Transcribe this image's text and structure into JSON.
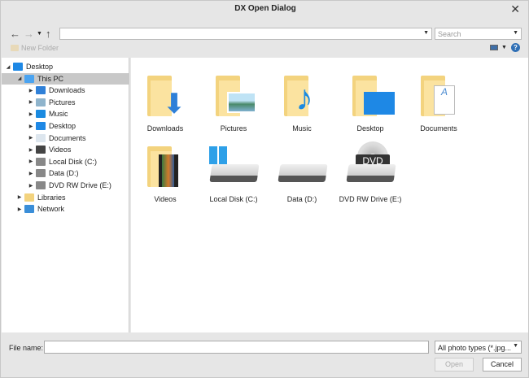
{
  "window": {
    "title": "DX Open Dialog"
  },
  "toolbar": {
    "back": "←",
    "forward": "→",
    "up": "↑",
    "address": "",
    "search_placeholder": "Search",
    "new_folder": "New Folder"
  },
  "tree": [
    {
      "label": "Desktop",
      "level": 0,
      "expanded": true,
      "icon": "desktop-icon",
      "color": "#1e88e5"
    },
    {
      "label": "This PC",
      "level": 1,
      "expanded": true,
      "selected": true,
      "icon": "pc-icon",
      "color": "#4aa3f0"
    },
    {
      "label": "Downloads",
      "level": 2,
      "icon": "downloads-icon",
      "color": "#2f80d8"
    },
    {
      "label": "Pictures",
      "level": 2,
      "icon": "pictures-icon",
      "color": "#8fb4cc"
    },
    {
      "label": "Music",
      "level": 2,
      "icon": "music-icon",
      "color": "#1a8ae0"
    },
    {
      "label": "Desktop",
      "level": 2,
      "icon": "desktop-icon",
      "color": "#1e88e5"
    },
    {
      "label": "Documents",
      "level": 2,
      "icon": "documents-icon",
      "color": "#dde6ee"
    },
    {
      "label": "Videos",
      "level": 2,
      "icon": "videos-icon",
      "color": "#444"
    },
    {
      "label": "Local Disk (C:)",
      "level": 2,
      "icon": "local-disk-icon",
      "color": "#888"
    },
    {
      "label": "Data (D:)",
      "level": 2,
      "icon": "drive-icon",
      "color": "#888"
    },
    {
      "label": "DVD RW Drive (E:)",
      "level": 2,
      "icon": "dvd-drive-icon",
      "color": "#888"
    },
    {
      "label": "Libraries",
      "level": 1,
      "icon": "libraries-icon",
      "color": "#f3d37e"
    },
    {
      "label": "Network",
      "level": 1,
      "icon": "network-icon",
      "color": "#3a8ed8"
    }
  ],
  "items": [
    {
      "label": "Downloads",
      "type": "folder",
      "overlay": "downloads"
    },
    {
      "label": "Pictures",
      "type": "folder",
      "overlay": "pictures"
    },
    {
      "label": "Music",
      "type": "folder",
      "overlay": "music"
    },
    {
      "label": "Desktop",
      "type": "folder",
      "overlay": "desktop"
    },
    {
      "label": "Documents",
      "type": "folder",
      "overlay": "documents"
    },
    {
      "label": "Videos",
      "type": "folder",
      "overlay": "videos"
    },
    {
      "label": "Local Disk (C:)",
      "type": "drive",
      "overlay": "windows"
    },
    {
      "label": "Data (D:)",
      "type": "drive",
      "overlay": ""
    },
    {
      "label": "DVD RW Drive (E:)",
      "type": "drive",
      "overlay": "dvd"
    }
  ],
  "dvd_label": "DVD",
  "footer": {
    "file_name_label": "File name:",
    "file_name_value": "",
    "file_type": "All photo types (*.jpg...",
    "open": "Open",
    "cancel": "Cancel"
  }
}
